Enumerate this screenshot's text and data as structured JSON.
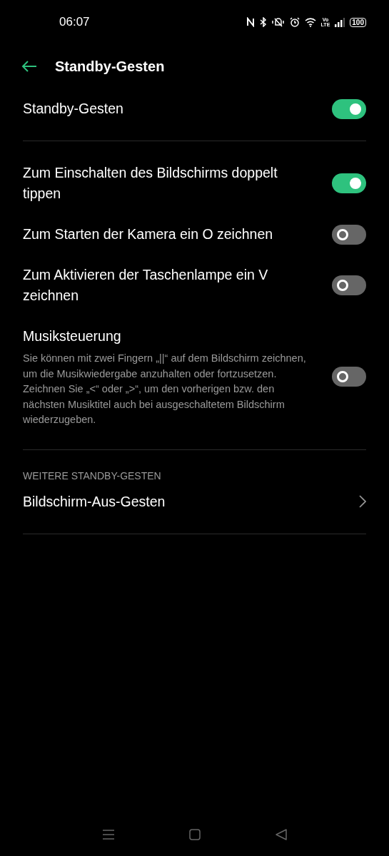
{
  "status_bar": {
    "time": "06:07",
    "volte": [
      "Vo",
      "LTE"
    ],
    "battery": "100"
  },
  "header": {
    "title": "Standby-Gesten"
  },
  "sections": [
    {
      "items": [
        {
          "kind": "toggle",
          "label": "Standby-Gesten",
          "on": true
        }
      ]
    },
    {
      "items": [
        {
          "kind": "toggle",
          "label": "Zum Einschalten des Bildschirms doppelt tippen",
          "on": true
        },
        {
          "kind": "toggle",
          "label": "Zum Starten der Kamera ein O zeichnen",
          "on": false
        },
        {
          "kind": "toggle",
          "label": "Zum Aktivieren der Taschenlampe ein V zeichnen",
          "on": false
        },
        {
          "kind": "toggle",
          "label": "Musiksteuerung",
          "description": "Sie können mit zwei Fingern „||“ auf dem Bildschirm zeichnen, um die Musikwiedergabe anzuhalten oder fortzusetzen. Zeichnen Sie „<“ oder „>“, um den vorherigen bzw. den nächsten Musiktitel auch bei ausgeschaltetem Bildschirm wiederzugeben.",
          "on": false
        }
      ]
    },
    {
      "heading": "WEITERE STANDBY-GESTEN",
      "items": [
        {
          "kind": "link",
          "label": "Bildschirm-Aus-Gesten"
        }
      ]
    }
  ]
}
